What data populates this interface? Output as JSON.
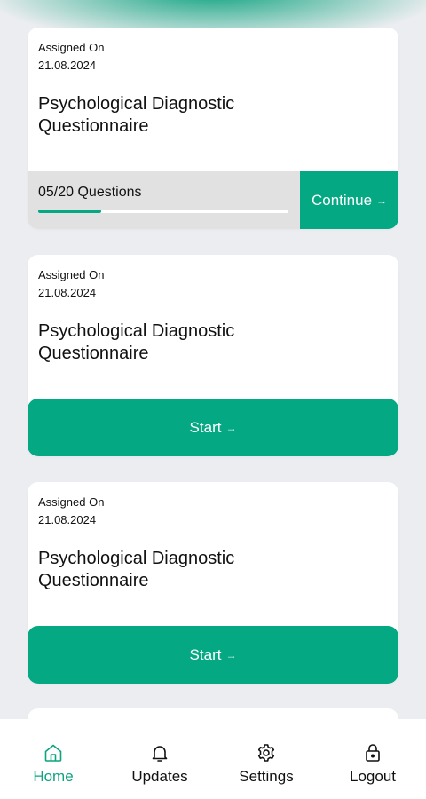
{
  "colors": {
    "accent": "#04a883",
    "progress_bg": "#e2e1e1",
    "page_bg": "#ebedf0"
  },
  "cards": [
    {
      "assigned_label": "Assigned On",
      "assigned_date": "21.08.2024",
      "title": "Psychological Diagnostic Questionnaire",
      "progress_text": "05/20 Questions",
      "progress_fraction": 0.25,
      "action_label": "Continue",
      "action_arrow": "→"
    },
    {
      "assigned_label": "Assigned On",
      "assigned_date": "21.08.2024",
      "title": "Psychological Diagnostic Questionnaire",
      "action_label": "Start",
      "action_arrow": "→"
    },
    {
      "assigned_label": "Assigned On",
      "assigned_date": "21.08.2024",
      "title": "Psychological Diagnostic Questionnaire",
      "action_label": "Start",
      "action_arrow": "→"
    }
  ],
  "tabbar": {
    "items": [
      {
        "label": "Home",
        "icon": "home-icon",
        "active": true
      },
      {
        "label": "Updates",
        "icon": "bell-icon",
        "active": false
      },
      {
        "label": "Settings",
        "icon": "gear-icon",
        "active": false
      },
      {
        "label": "Logout",
        "icon": "lock-icon",
        "active": false
      }
    ]
  }
}
